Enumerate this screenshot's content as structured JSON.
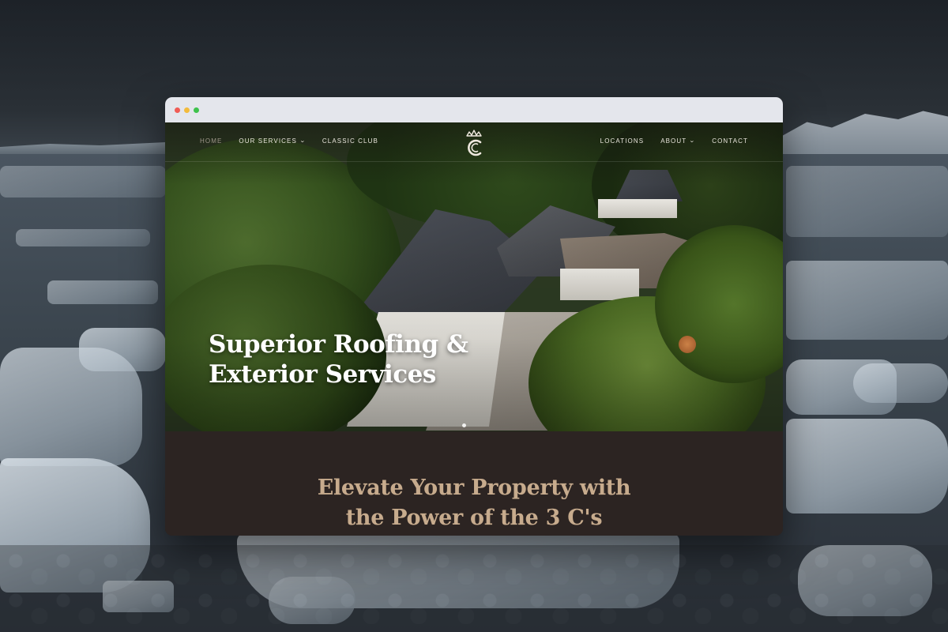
{
  "window": {
    "controls": [
      "close",
      "minimize",
      "maximize"
    ]
  },
  "nav": {
    "left": [
      {
        "label": "Home",
        "active": true,
        "dropdown": false
      },
      {
        "label": "Our Services",
        "active": false,
        "dropdown": true
      },
      {
        "label": "Classic Club",
        "active": false,
        "dropdown": false
      }
    ],
    "right": [
      {
        "label": "Locations",
        "dropdown": false
      },
      {
        "label": "About",
        "dropdown": true
      },
      {
        "label": "Contact",
        "dropdown": false
      }
    ],
    "logo_icon": "crown-c-logo"
  },
  "hero": {
    "title_line1": "Superior Roofing &",
    "title_line2": "Exterior Services",
    "slides_count": 1
  },
  "intro": {
    "title_line1": "Elevate Your Property with",
    "title_line2": "the Power of the 3 C's"
  },
  "colors": {
    "accent_gold": "#c7ab8d",
    "section_bg": "#2c2422",
    "nav_text": "#e9e5dc"
  }
}
